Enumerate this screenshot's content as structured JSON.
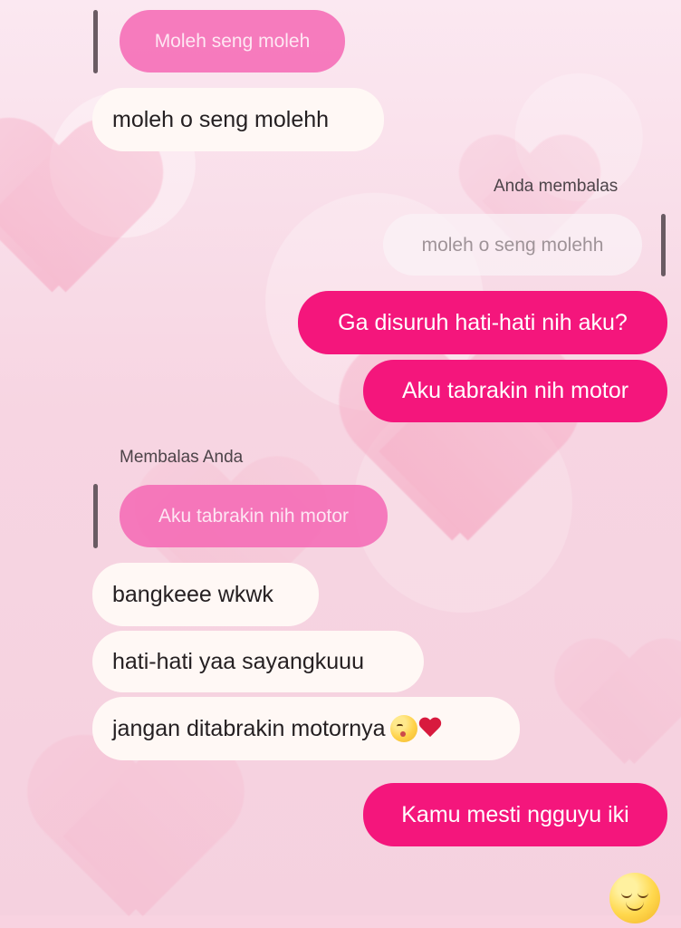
{
  "messages": {
    "quote_top_incoming": "Moleh seng moleh",
    "incoming_1": "moleh o seng molehh",
    "reply_label_outgoing": "Anda membalas",
    "quote_outgoing": "moleh o seng molehh",
    "outgoing_1": "Ga disuruh hati-hati nih aku?",
    "outgoing_2": "Aku tabrakin nih motor",
    "reply_label_incoming": "Membalas Anda",
    "quote_incoming_2": "Aku tabrakin nih motor",
    "incoming_2": "bangkeee wkwk",
    "incoming_3": "hati-hati yaa sayangkuuu",
    "incoming_4": "jangan ditabrakin motornya",
    "outgoing_3": "Kamu mesti ngguyu iki"
  },
  "icons": {
    "incoming_4_emojis": [
      "kiss-emoji",
      "red-heart-emoji"
    ],
    "bottom_right_emoji": "relieved-face-emoji"
  },
  "colors": {
    "background": "#f8d3e1",
    "outgoing_bubble": "#f4167c",
    "incoming_bubble": "#fff8f5",
    "quoted_pink": "#f467b4"
  }
}
